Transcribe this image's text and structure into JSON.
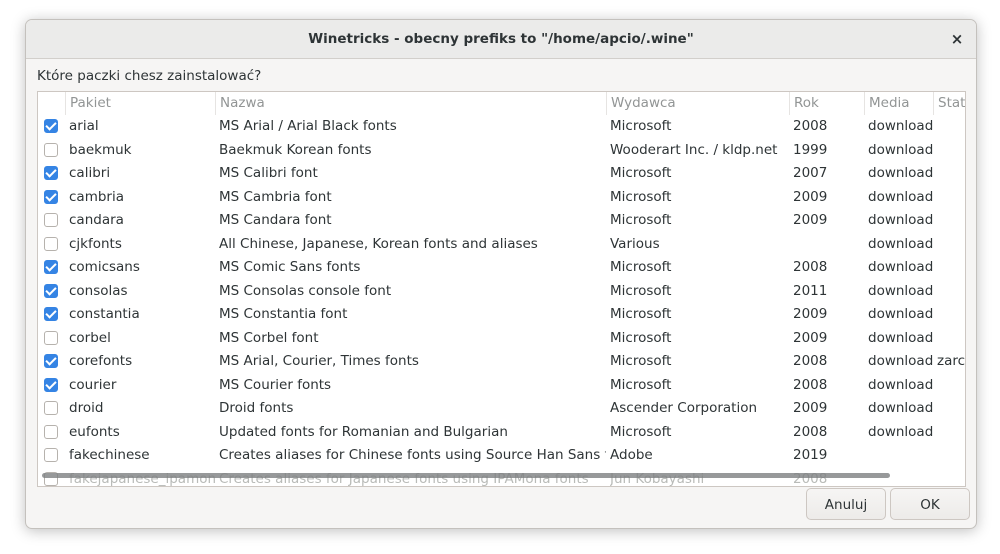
{
  "window": {
    "title": "Winetricks - obecny prefiks to \"/home/apcio/.wine\"",
    "close_glyph": "×"
  },
  "question": "Które paczki chesz zainstalować?",
  "columns": {
    "package": "Pakiet",
    "name": "Nazwa",
    "publisher": "Wydawca",
    "year": "Rok",
    "media": "Media",
    "status": "Stat"
  },
  "rows": [
    {
      "checked": true,
      "package": "arial",
      "name": "MS Arial / Arial Black fonts",
      "publisher": "Microsoft",
      "year": "2008",
      "media": "download",
      "status": ""
    },
    {
      "checked": false,
      "package": "baekmuk",
      "name": "Baekmuk Korean fonts",
      "publisher": "Wooderart Inc. / kldp.net",
      "year": "1999",
      "media": "download",
      "status": ""
    },
    {
      "checked": true,
      "package": "calibri",
      "name": "MS Calibri font",
      "publisher": "Microsoft",
      "year": "2007",
      "media": "download",
      "status": ""
    },
    {
      "checked": true,
      "package": "cambria",
      "name": "MS Cambria font",
      "publisher": "Microsoft",
      "year": "2009",
      "media": "download",
      "status": ""
    },
    {
      "checked": false,
      "package": "candara",
      "name": "MS Candara font",
      "publisher": "Microsoft",
      "year": "2009",
      "media": "download",
      "status": ""
    },
    {
      "checked": false,
      "package": "cjkfonts",
      "name": "All Chinese, Japanese, Korean fonts and aliases",
      "publisher": "Various",
      "year": "",
      "media": "download",
      "status": ""
    },
    {
      "checked": true,
      "package": "comicsans",
      "name": "MS Comic Sans fonts",
      "publisher": "Microsoft",
      "year": "2008",
      "media": "download",
      "status": ""
    },
    {
      "checked": true,
      "package": "consolas",
      "name": "MS Consolas console font",
      "publisher": "Microsoft",
      "year": "2011",
      "media": "download",
      "status": ""
    },
    {
      "checked": true,
      "package": "constantia",
      "name": "MS Constantia font",
      "publisher": "Microsoft",
      "year": "2009",
      "media": "download",
      "status": ""
    },
    {
      "checked": false,
      "package": "corbel",
      "name": "MS Corbel font",
      "publisher": "Microsoft",
      "year": "2009",
      "media": "download",
      "status": ""
    },
    {
      "checked": true,
      "package": "corefonts",
      "name": "MS Arial, Courier, Times fonts",
      "publisher": "Microsoft",
      "year": "2008",
      "media": "download",
      "status": "zarc"
    },
    {
      "checked": true,
      "package": "courier",
      "name": "MS Courier fonts",
      "publisher": "Microsoft",
      "year": "2008",
      "media": "download",
      "status": ""
    },
    {
      "checked": false,
      "package": "droid",
      "name": "Droid fonts",
      "publisher": "Ascender Corporation",
      "year": "2009",
      "media": "download",
      "status": ""
    },
    {
      "checked": false,
      "package": "eufonts",
      "name": "Updated fonts for Romanian and Bulgarian",
      "publisher": "Microsoft",
      "year": "2008",
      "media": "download",
      "status": ""
    },
    {
      "checked": false,
      "package": "fakechinese",
      "name": "Creates aliases for Chinese fonts using Source Han Sans fonts",
      "publisher": "Adobe",
      "year": "2019",
      "media": "",
      "status": ""
    },
    {
      "checked": false,
      "package": "fakejapanese_ipamona",
      "name": "Creates aliases for Japanese fonts using IPAMona fonts",
      "publisher": "Jun Kobayashi",
      "year": "2008",
      "media": "",
      "status": ""
    }
  ],
  "buttons": {
    "cancel": "Anuluj",
    "ok": "OK"
  },
  "colors": {
    "accent": "#3584e4",
    "header_text": "#929595"
  }
}
